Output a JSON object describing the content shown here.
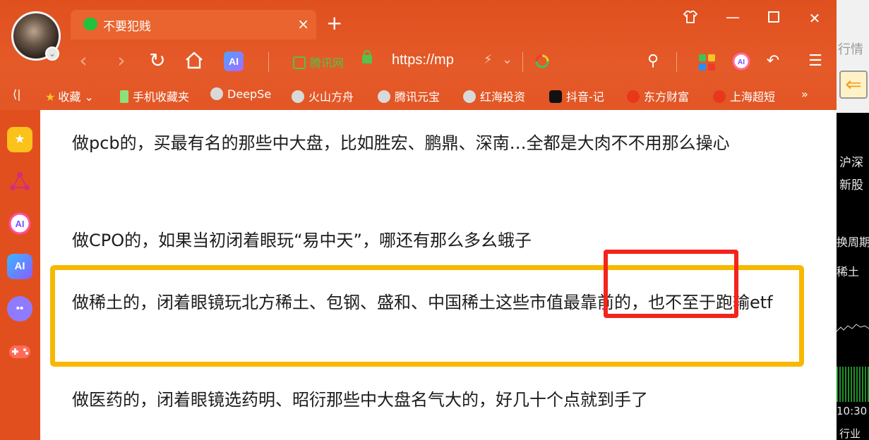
{
  "browser": {
    "tab": {
      "title": "不要犯贱",
      "close": "×"
    },
    "new_tab": "+",
    "window_controls": {
      "skin": "👕",
      "minimize": "—",
      "maximize": "☐",
      "close": "✕"
    },
    "nav": {
      "back": "‹",
      "forward": "›",
      "reload": "↻",
      "home": "⌂",
      "ai": "AI"
    },
    "address": {
      "site_name": "腾讯网",
      "url": "https://mp",
      "flash": "⚡",
      "dropdown": "⌄"
    },
    "toolbar_right": {
      "search": "⚲",
      "undo": "↶",
      "menu": "☰",
      "ai_color": "AI"
    }
  },
  "bookmarks": [
    {
      "label": "收藏",
      "icon": "star-icon"
    },
    {
      "label": "手机收藏夹",
      "icon": "phone-icon"
    },
    {
      "label": "DeepSe",
      "icon": "globe-icon"
    },
    {
      "label": "火山方舟",
      "icon": "globe-icon"
    },
    {
      "label": "腾讯元宝",
      "icon": "globe-icon"
    },
    {
      "label": "红海投资",
      "icon": "globe-icon"
    },
    {
      "label": "抖音-记",
      "icon": "tiktok-icon"
    },
    {
      "label": "东方财富",
      "icon": "fox-icon"
    },
    {
      "label": "上海超短",
      "icon": "fox-icon"
    }
  ],
  "bookmarks_extra": {
    "left": "⟨|",
    "more": "»"
  },
  "sidebar": {
    "ai_label": "AI"
  },
  "content": {
    "paragraphs": [
      "做pcb的，买最有名的那些中大盘，比如胜宏、鹏鼎、深南…全都是大肉不不用那么操心",
      "做CPO的，如果当初闭着眼玩“易中天”，哪还有那么多幺蛾子",
      "做稀土的，闭着眼镜玩北方稀土、包钢、盛和、中国稀土这些市值最靠前的，也不至于跑输etf",
      "做医药的，闭着眼镜选药明、昭衍那些中大盘名气大的，好几十个点就到手了"
    ]
  },
  "background_window": {
    "labels": [
      "行情",
      "沪深",
      "新股",
      "换周期",
      "稀土",
      "10:30",
      "行业"
    ]
  },
  "colors": {
    "chrome": "#e35626",
    "highlight_yellow": "#f7b800",
    "highlight_red": "#f3241b"
  }
}
